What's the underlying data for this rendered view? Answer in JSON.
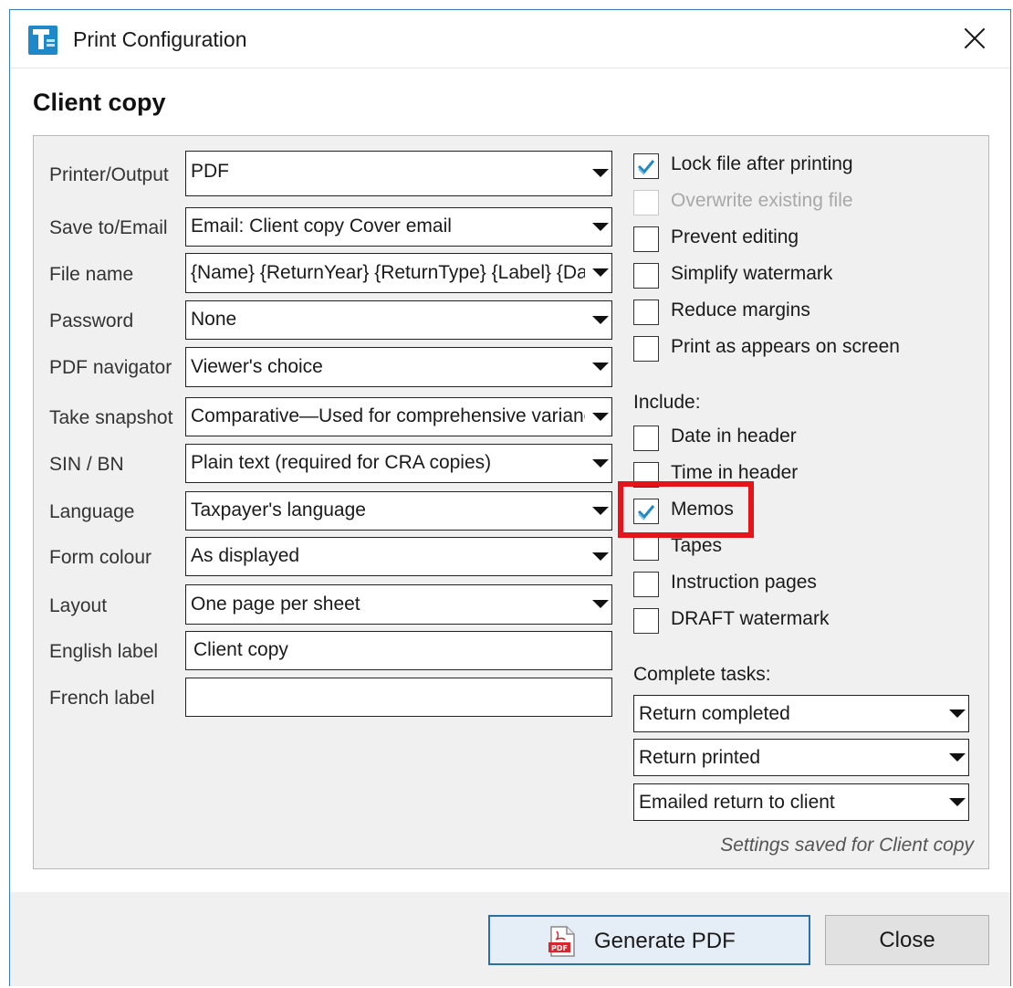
{
  "window": {
    "title": "Print Configuration"
  },
  "section_title": "Client copy",
  "fields": [
    {
      "label": "Printer/Output",
      "value": "PDF",
      "type": "select"
    },
    {
      "label": "Save to/Email",
      "value": "Email: Client copy Cover email",
      "type": "select"
    },
    {
      "label": "File name",
      "value": "{Name} {ReturnYear} {ReturnType} {Label} {Date}",
      "type": "select"
    },
    {
      "label": "Password",
      "value": "None",
      "type": "select"
    },
    {
      "label": "PDF navigator",
      "value": "Viewer's choice",
      "type": "select"
    },
    {
      "label": "Take snapshot",
      "value": "Comparative—Used for comprehensive variance",
      "type": "select"
    },
    {
      "label": "SIN / BN",
      "value": "Plain text (required for CRA copies)",
      "type": "select"
    },
    {
      "label": "Language",
      "value": "Taxpayer's language",
      "type": "select"
    },
    {
      "label": "Form colour",
      "value": "As displayed",
      "type": "select"
    },
    {
      "label": "Layout",
      "value": "One page per sheet",
      "type": "select"
    },
    {
      "label": "English label",
      "value": "Client copy",
      "type": "text"
    },
    {
      "label": "French label",
      "value": "",
      "type": "text"
    }
  ],
  "options": [
    {
      "label": "Lock file after printing",
      "checked": true,
      "disabled": false
    },
    {
      "label": "Overwrite existing file",
      "checked": false,
      "disabled": true
    },
    {
      "label": "Prevent editing",
      "checked": false,
      "disabled": false
    },
    {
      "label": "Simplify watermark",
      "checked": false,
      "disabled": false
    },
    {
      "label": "Reduce margins",
      "checked": false,
      "disabled": false
    },
    {
      "label": "Print as appears on screen",
      "checked": false,
      "disabled": false
    }
  ],
  "include": {
    "label": "Include:",
    "items": [
      {
        "label": "Date in header",
        "checked": false
      },
      {
        "label": "Time in header",
        "checked": false
      },
      {
        "label": "Memos",
        "checked": true
      },
      {
        "label": "Tapes",
        "checked": false
      },
      {
        "label": "Instruction pages",
        "checked": false
      },
      {
        "label": "DRAFT watermark",
        "checked": false
      }
    ]
  },
  "complete_tasks": {
    "label": "Complete tasks:",
    "selects": [
      "Return completed",
      "Return printed",
      "Emailed return to client"
    ]
  },
  "saved_note": "Settings saved for Client copy",
  "buttons": {
    "generate": "Generate PDF",
    "pdf_icon_text": "PDF",
    "close": "Close"
  },
  "colors": {
    "highlight": "#e4141a",
    "accent": "#2a6fa8",
    "check": "#1e88c9"
  }
}
